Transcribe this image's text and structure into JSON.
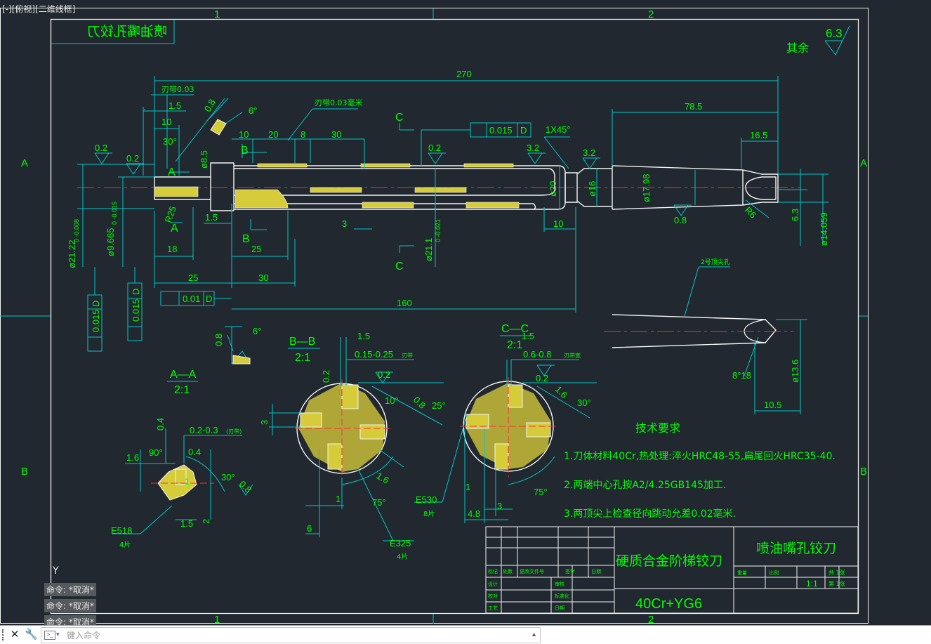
{
  "viewport": {
    "label": "[-][俯视][二维线框]"
  },
  "ucs": {
    "y_label": "Y"
  },
  "grid_refs": {
    "col1": "1",
    "col2": "2",
    "rowA": "A",
    "rowB": "B"
  },
  "drawing": {
    "title_box_mirrored": "喷油嘴孔铰刀",
    "surface_rest": "其余",
    "surface_default": "6.3",
    "dims": {
      "overall": "270",
      "shank_len": "78.5",
      "d_16_5": "16.5",
      "rake": "刃带0.03",
      "rake2": "刃带0.03毫米",
      "d_1_5": "1.5",
      "d_10a": "10",
      "d_30deg": "30°",
      "ang_6": "6°",
      "r_08": "0.8",
      "d_10": "10",
      "d_20": "20",
      "d_8": "8",
      "d_30": "30",
      "tol_015": "0.015",
      "datum_d": "D",
      "chamfer": "1X45°",
      "r_02a": "0.2",
      "r_02b": "0.2",
      "r_02c": "0.2",
      "r_32a": "3.2",
      "r_32b": "3.2",
      "dia_85": "ø8.5",
      "dia_20": "ø20",
      "dia_16": "ø16",
      "dia_1798": "ø17.98",
      "r6": "R6",
      "d_63": "6.3",
      "dia_14059": "ø14.059",
      "r25": "R25",
      "d_15b": "1.5",
      "d_3": "3",
      "dia_211": "ø21.1",
      "tol_211": "0 -0.021",
      "d_10b": "10",
      "d_08": "0.8",
      "dia_2122": "ø21.22",
      "tol_2122": "0 -0.008",
      "dia_9665": "ø9.665",
      "tol_9665": "0 -0.015",
      "d_18": "18",
      "d_25a": "25",
      "d_25b": "25",
      "d_30b": "30",
      "perp_tol": "0.01",
      "d_160": "160",
      "sec_A": "A",
      "sec_B": "B",
      "sec_C": "C",
      "center_hole": "2号顶尖孔",
      "ang_818": "8°18",
      "dia_136": "ø13.6",
      "d_105": "10.5",
      "aa_title": "A—A",
      "scale21": "2:1",
      "bb_title": "B—B",
      "cc_title": "C—C",
      "aa_04": "0.4",
      "aa_0203": "0.2-0.3",
      "aa_0203_note": "(刃带)",
      "aa_16": "1.6",
      "aa_90": "90°",
      "aa_04b": "0.4",
      "aa_30": "30°",
      "aa_08": "0.8",
      "aa_15": "1.5",
      "aa_2": "2",
      "aa_1": "1",
      "e518": "E518",
      "e518_n": "4片",
      "bb_15": "1.5",
      "bb_015": "0.15-0.25",
      "bb_015_note": "刃带",
      "bb_02a": "0.2",
      "bb_02b": "0.2",
      "bb_10": "10°",
      "bb_08": "0.8",
      "bb_25": "25°",
      "bb_3": "3",
      "bb_16": "1.6",
      "bb_75": "75°",
      "bb_1": "1",
      "bb_6": "6",
      "e325": "E325",
      "e325_n": "4片",
      "cc_15": "1.5",
      "cc_0608": "0.6-0.8",
      "cc_0608_note": "刃带宽",
      "cc_02": "0.2",
      "cc_16": "1.6",
      "cc_30": "30°",
      "cc_75": "75°",
      "cc_1": "1",
      "cc_48": "4.8",
      "cc_3": "3",
      "e530": "E530",
      "e530_n": "8片"
    },
    "tech_title": "技术要求",
    "tech_notes": [
      "1.刀体材料40Cr,热处理:淬火HRC48-55,扁尾回火HRC35-40.",
      "2.两端中心孔按A2/4.25GB145加工.",
      "3.两顶尖上检查径向跳动允差0.02毫米."
    ],
    "title_block": {
      "part_name": "硬质合金阶梯铰刀",
      "drawing_name": "喷油嘴孔铰刀",
      "material": "40Cr+YG6",
      "scale": "1:1",
      "sheets": "共 1张",
      "sheet_no": "第 1张",
      "h_mark": "标记",
      "h_count": "处数",
      "h_doc": "更改文件号",
      "h_sign": "签字",
      "h_date": "日期",
      "h_design": "设计",
      "h_check": "审核",
      "h_proof": "校对",
      "h_std": "标准化",
      "h_process": "工艺",
      "h_date2": "日期",
      "h_weight": "重量",
      "h_ratio": "比例"
    }
  },
  "command": {
    "history": [
      "命令: *取消*",
      "命令: *取消*",
      "命令: *取消*"
    ],
    "placeholder": "键入命令"
  }
}
